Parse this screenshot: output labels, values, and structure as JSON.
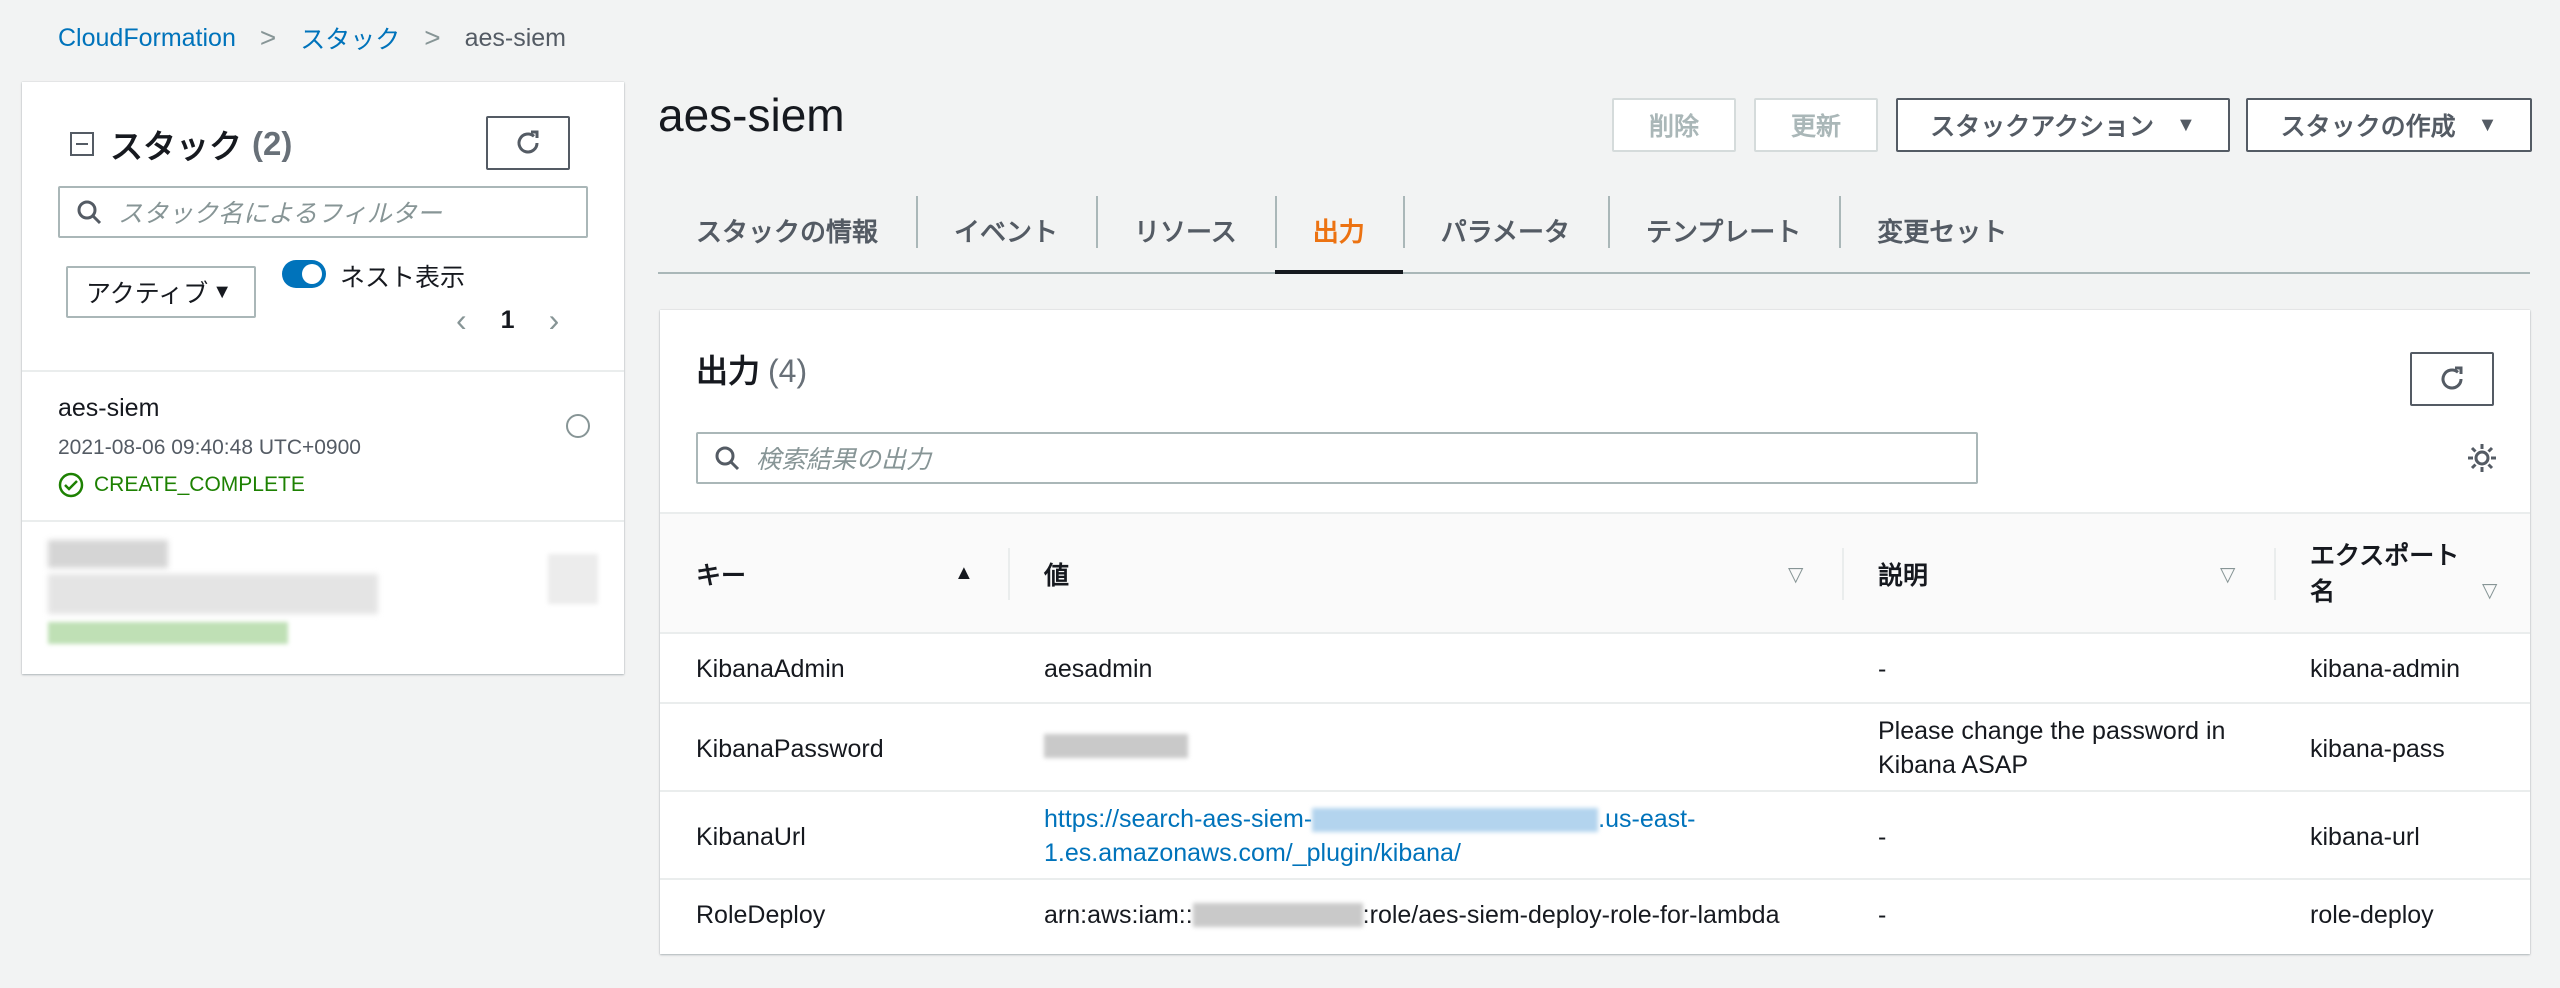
{
  "breadcrumb": {
    "root": "CloudFormation",
    "stacks": "スタック",
    "current": "aes-siem",
    "separator": ">"
  },
  "left_panel": {
    "title": "スタック",
    "count": "(2)",
    "search_placeholder": "スタック名によるフィルター",
    "filter_select": "アクティブ",
    "nest_toggle_label": "ネスト表示",
    "page": "1",
    "stacks": [
      {
        "name": "aes-siem",
        "created": "2021-08-06 09:40:48 UTC+0900",
        "status": "CREATE_COMPLETE"
      }
    ]
  },
  "main": {
    "title": "aes-siem",
    "buttons": {
      "delete": "削除",
      "update": "更新",
      "stack_actions": "スタックアクション",
      "create_stack": "スタックの作成"
    },
    "tabs": [
      {
        "label": "スタックの情報"
      },
      {
        "label": "イベント"
      },
      {
        "label": "リソース"
      },
      {
        "label": "出力"
      },
      {
        "label": "パラメータ"
      },
      {
        "label": "テンプレート"
      },
      {
        "label": "変更セット"
      }
    ],
    "active_tab": "出力"
  },
  "outputs": {
    "title": "出力",
    "count": "(4)",
    "search_placeholder": "検索結果の出力",
    "columns": {
      "key": "キー",
      "value": "値",
      "description": "説明",
      "export_line1": "エクスポート",
      "export_line2": "名"
    },
    "rows": [
      {
        "key": "KibanaAdmin",
        "value": "aesadmin",
        "description": "-",
        "export": "kibana-admin"
      },
      {
        "key": "KibanaPassword",
        "value": "",
        "description_line1": "Please change the password in",
        "description_line2": "Kibana ASAP",
        "export": "kibana-pass"
      },
      {
        "key": "KibanaUrl",
        "value_prefix": "https://search-aes-siem-",
        "value_suffix": ".us-east-",
        "value_line2": "1.es.amazonaws.com/_plugin/kibana/",
        "description": "-",
        "export": "kibana-url"
      },
      {
        "key": "RoleDeploy",
        "value_prefix": "arn:aws:iam::",
        "value_suffix": ":role/aes-siem-deploy-role-for-lambda",
        "description": "-",
        "export": "role-deploy"
      }
    ]
  },
  "colors": {
    "link": "#0073bb",
    "active_tab": "#ec7211",
    "success": "#1d8102",
    "background": "#f2f3f3"
  }
}
